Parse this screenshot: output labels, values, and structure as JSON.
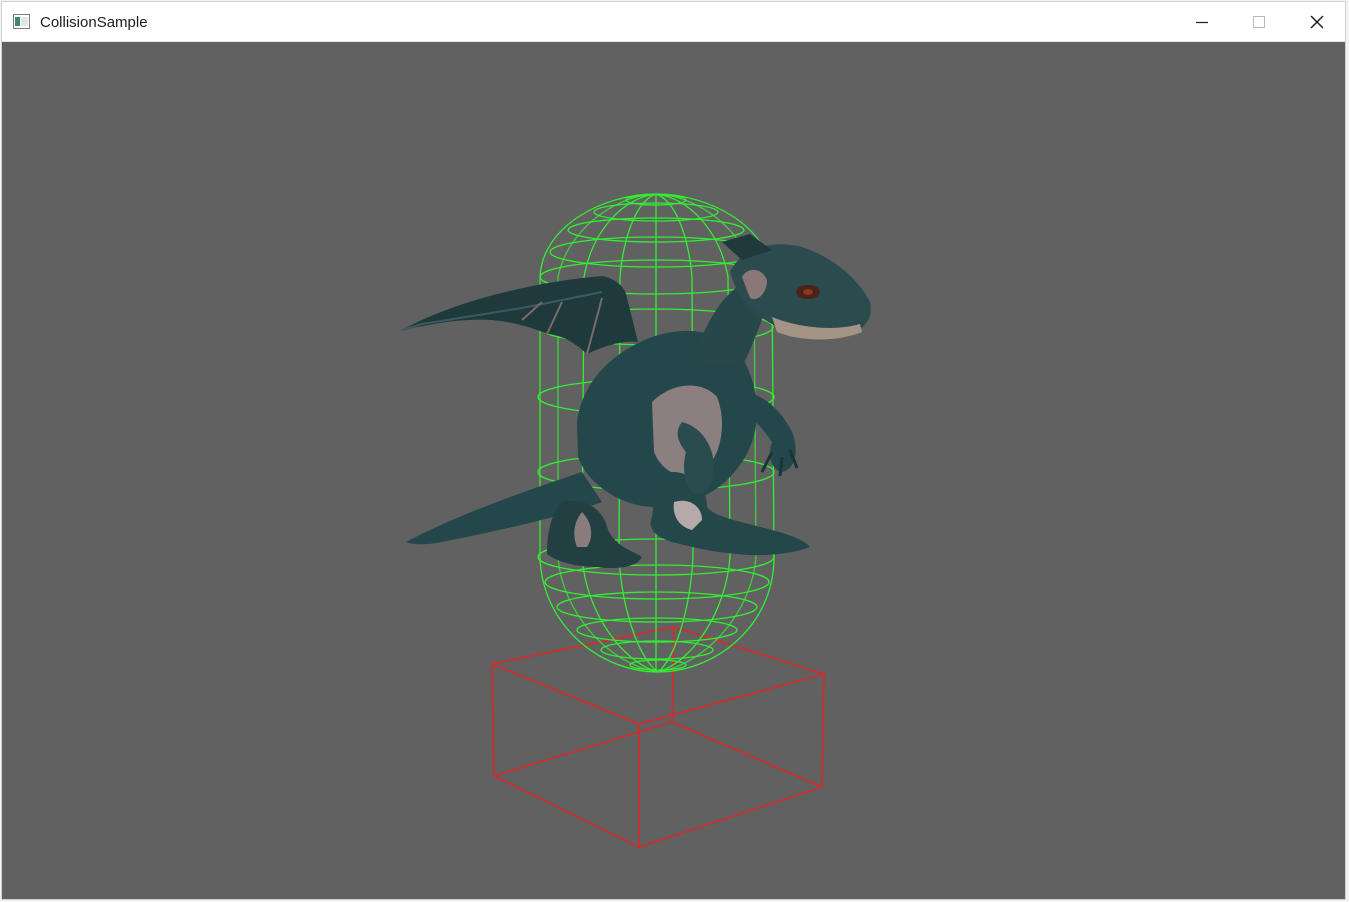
{
  "window": {
    "title": "CollisionSample",
    "icon": "app-window-icon",
    "controls": {
      "minimize_icon": "minimize-icon",
      "maximize_icon": "maximize-icon",
      "close_icon": "close-icon"
    }
  },
  "viewport": {
    "background_color": "#616161",
    "objects": [
      {
        "name": "dragon-model",
        "kind": "3d-character"
      },
      {
        "name": "capsule-collider",
        "kind": "wireframe-capsule",
        "color": "#33ff33"
      },
      {
        "name": "box-collider",
        "kind": "wireframe-box",
        "color": "#e02828"
      }
    ]
  }
}
